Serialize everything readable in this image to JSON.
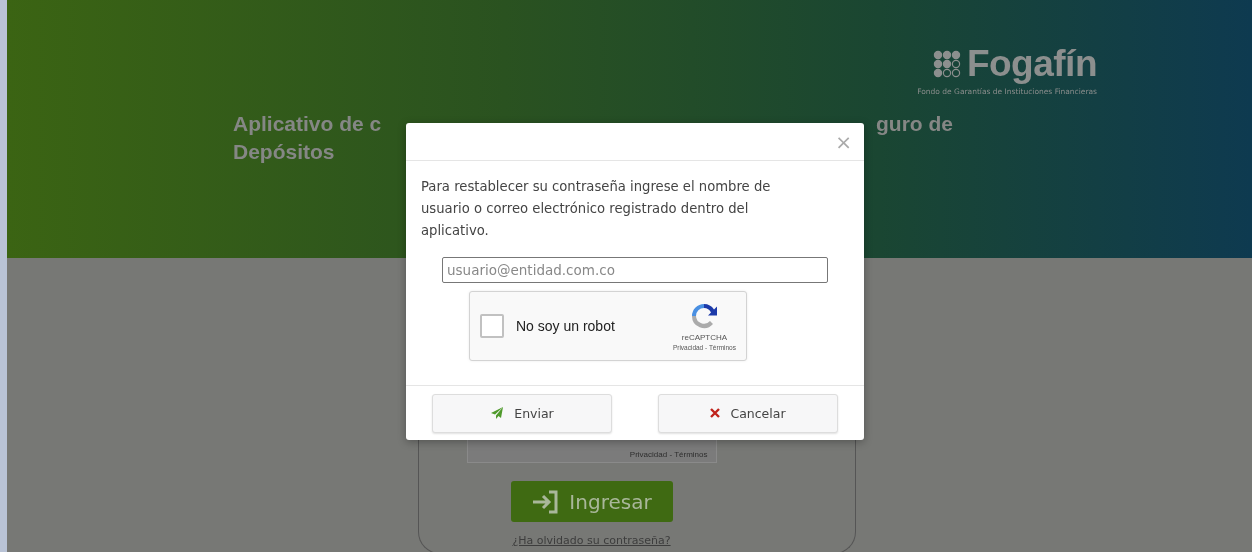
{
  "header": {
    "logo": {
      "name": "Fogafín",
      "tagline": "Fondo de Garantías de Instituciones Financieras"
    },
    "title": {
      "first_line_left": "Aplicativo de c",
      "first_line_right": "guro de",
      "second_line": "Depósitos"
    }
  },
  "login_card": {
    "captcha_links": "Privacidad - Términos",
    "submit_button": "Ingresar",
    "forgot_link": "¿Ha olvidado su contraseña?"
  },
  "dialog": {
    "close": "×",
    "message": "Para restablecer su contraseña ingrese el nombre de usuario o correo electrónico registrado dentro del aplicativo.",
    "email_field": {
      "placeholder": "usuario@entidad.com.co"
    },
    "captcha": {
      "label": "No soy un robot",
      "checked": false,
      "brand": "reCAPTCHA",
      "links": "Privacidad - Términos"
    },
    "buttons": [
      {
        "kind": "send",
        "label": "Enviar"
      },
      {
        "kind": "cancel",
        "label": "Cancelar"
      }
    ]
  }
}
